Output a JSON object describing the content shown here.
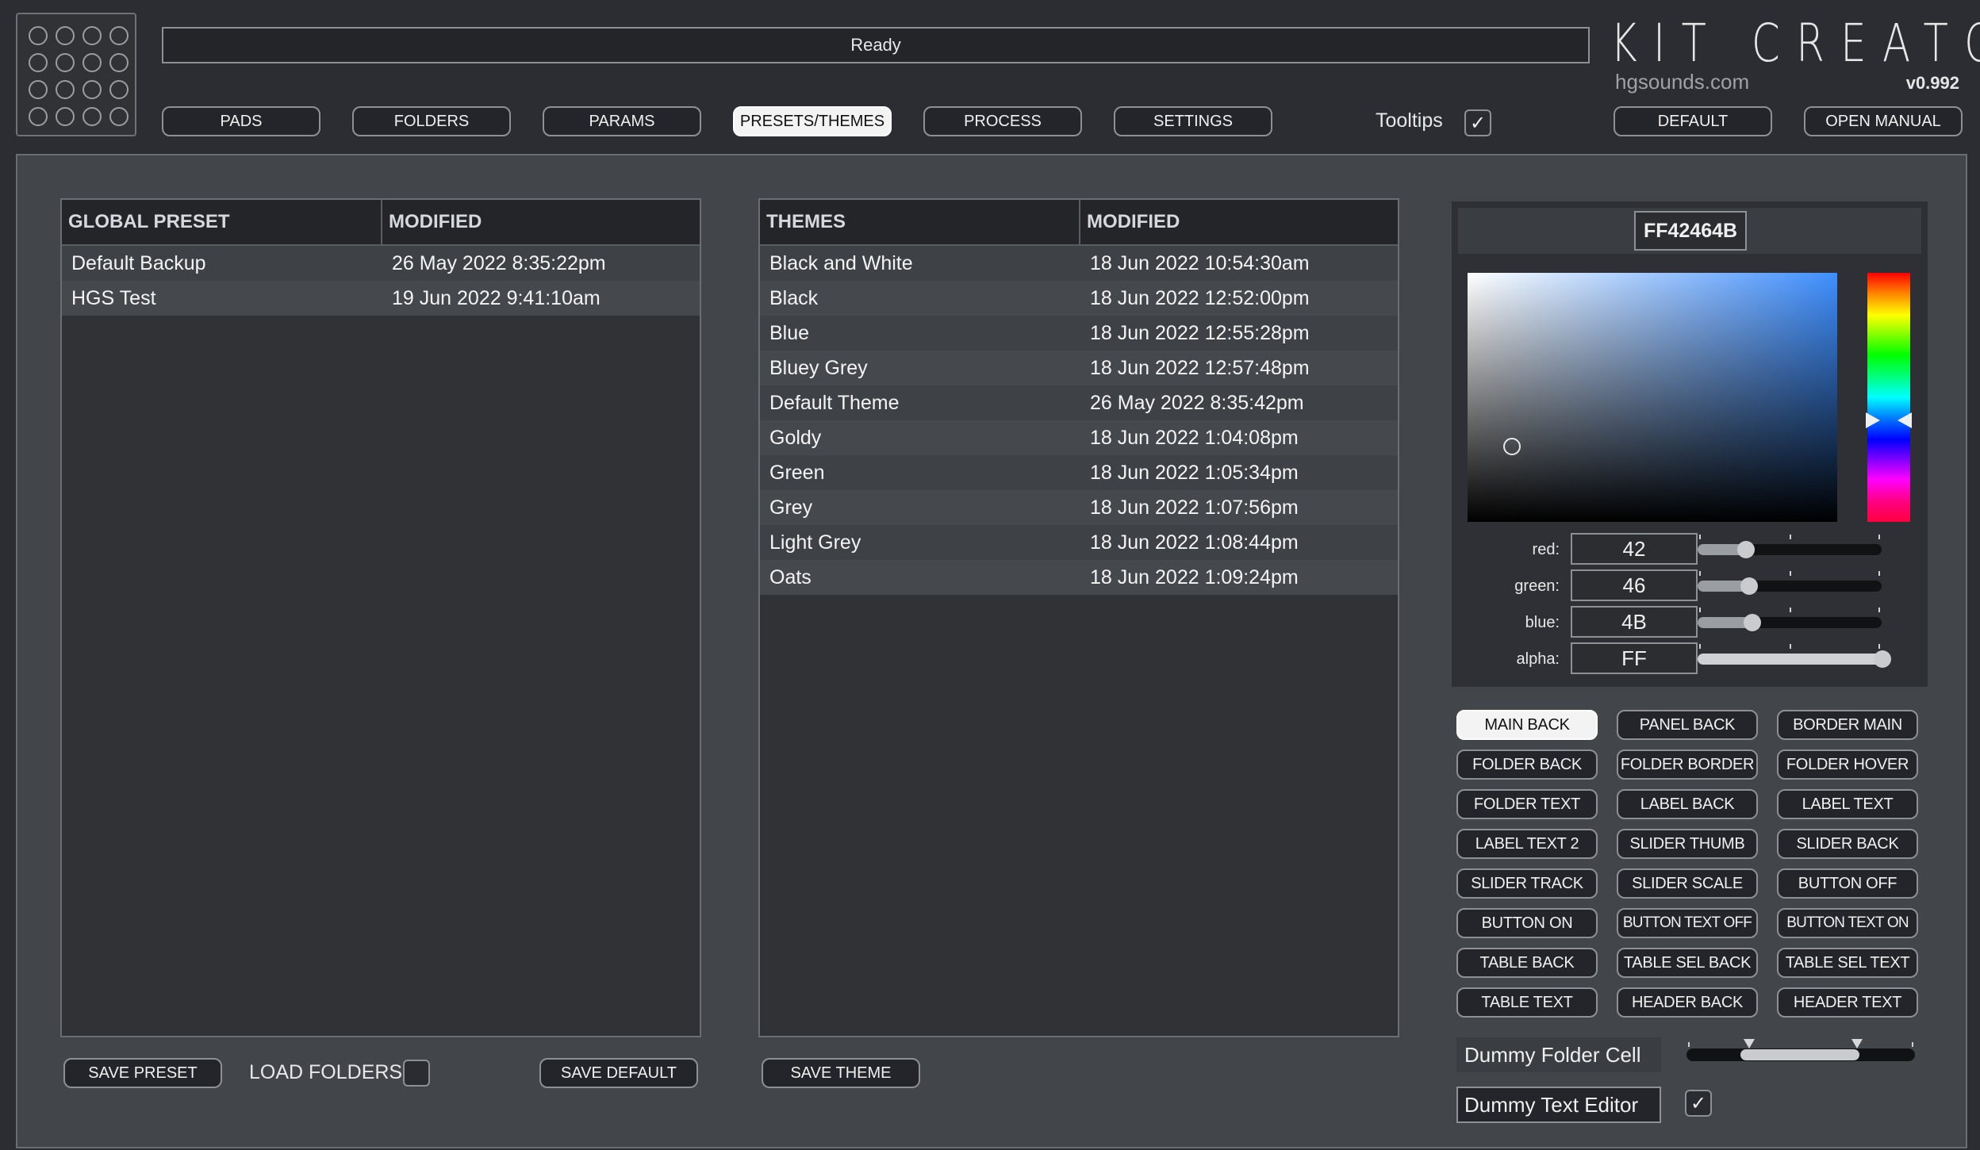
{
  "status": "Ready",
  "brand": {
    "title": "KIT CREATOR",
    "website": "hgsounds.com",
    "version": "v0.992"
  },
  "nav": {
    "tabs": [
      "PADS",
      "FOLDERS",
      "PARAMS",
      "PRESETS/THEMES",
      "PROCESS",
      "SETTINGS"
    ],
    "active_tab": "PRESETS/THEMES",
    "tooltips_label": "Tooltips",
    "tooltips_checked": true,
    "default_label": "DEFAULT",
    "manual_label": "OPEN MANUAL"
  },
  "presets": {
    "headers": [
      "GLOBAL PRESET",
      "MODIFIED"
    ],
    "rows": [
      {
        "name": "Default Backup",
        "modified": "26 May 2022 8:35:22pm"
      },
      {
        "name": "HGS Test",
        "modified": "19 Jun 2022 9:41:10am"
      }
    ],
    "save_preset_label": "SAVE PRESET",
    "load_folders_label": "LOAD FOLDERS",
    "load_folders_checked": false,
    "save_default_label": "SAVE DEFAULT"
  },
  "themes": {
    "headers": [
      "THEMES",
      "MODIFIED"
    ],
    "rows": [
      {
        "name": "Black and White",
        "modified": "18 Jun 2022 10:54:30am"
      },
      {
        "name": "Black",
        "modified": "18 Jun 2022 12:52:00pm"
      },
      {
        "name": "Blue",
        "modified": "18 Jun 2022 12:55:28pm"
      },
      {
        "name": "Bluey Grey",
        "modified": "18 Jun 2022 12:57:48pm"
      },
      {
        "name": "Default Theme",
        "modified": "26 May 2022 8:35:42pm"
      },
      {
        "name": "Goldy",
        "modified": "18 Jun 2022 1:04:08pm"
      },
      {
        "name": "Green",
        "modified": "18 Jun 2022 1:05:34pm"
      },
      {
        "name": "Grey",
        "modified": "18 Jun 2022 1:07:56pm"
      },
      {
        "name": "Light Grey",
        "modified": "18 Jun 2022 1:08:44pm"
      },
      {
        "name": "Oats",
        "modified": "18 Jun 2022 1:09:24pm"
      }
    ],
    "save_theme_label": "SAVE THEME"
  },
  "color_picker": {
    "hex": "FF42464B",
    "channels": [
      {
        "label": "red:",
        "value": "42",
        "level": 0.26
      },
      {
        "label": "green:",
        "value": "46",
        "level": 0.27
      },
      {
        "label": "blue:",
        "value": "4B",
        "level": 0.29
      },
      {
        "label": "alpha:",
        "value": "FF",
        "level": 1.0
      }
    ],
    "selected_color": "#42464B"
  },
  "color_targets": {
    "labels": [
      "MAIN BACK",
      "PANEL BACK",
      "BORDER MAIN",
      "FOLDER BACK",
      "FOLDER BORDER",
      "FOLDER HOVER",
      "FOLDER TEXT",
      "LABEL BACK",
      "LABEL TEXT",
      "LABEL TEXT 2",
      "SLIDER THUMB",
      "SLIDER BACK",
      "SLIDER TRACK",
      "SLIDER SCALE",
      "BUTTON OFF",
      "BUTTON ON",
      "BUTTON TEXT OFF",
      "BUTTON TEXT ON",
      "TABLE BACK",
      "TABLE SEL BACK",
      "TABLE SEL TEXT",
      "TABLE TEXT",
      "HEADER BACK",
      "HEADER TEXT"
    ],
    "active": "MAIN BACK"
  },
  "dummies": {
    "folder_cell": "Dummy Folder Cell",
    "text_editor": "Dummy Text Editor",
    "checkbox_checked": true
  },
  "colors": {
    "main_back": "#42464B",
    "panel_back": "#2b2d32",
    "button_back": "#23252a",
    "accent": "#f3f3f3"
  }
}
